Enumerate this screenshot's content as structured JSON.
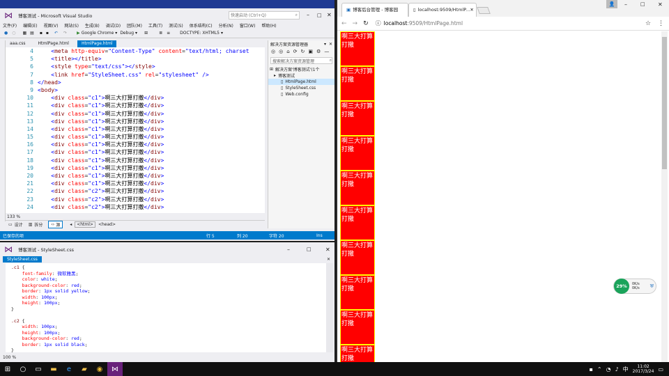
{
  "vs_top": {
    "title": "博客测试 - Microsoft Visual Studio",
    "quick_launch": "快速启动 (Ctrl+Q)",
    "menu": [
      "文件(F)",
      "编辑(E)",
      "视图(V)",
      "网站(S)",
      "生成(B)",
      "调试(D)",
      "团队(M)",
      "工具(T)",
      "测试(S)",
      "体系结构(C)",
      "分析(N)",
      "窗口(W)",
      "帮助(H)"
    ],
    "toolbar": {
      "browser": "Google Chrome",
      "config": "Debug",
      "doctype": "DOCTYPE: XHTML5"
    },
    "tabs": [
      "aaa.css",
      "HtmlPage.html",
      "HtmlPage.html"
    ],
    "code_lines": [
      {
        "n": "4",
        "html": "    <span class='br'>&lt;</span><span class='tagc'>meta</span> <span class='attr'>http-equiv</span>=<span class='val'>\"Content-Type\"</span> <span class='attr'>content</span>=<span class='val'>\"text/html; charset</span>"
      },
      {
        "n": "5",
        "html": "    <span class='br'>&lt;</span><span class='tagc'>title</span><span class='br'>&gt;&lt;/</span><span class='tagc'>title</span><span class='br'>&gt;</span>"
      },
      {
        "n": "6",
        "html": "    <span class='br'>&lt;</span><span class='tagc'>style</span> <span class='attr'>type</span>=<span class='val'>\"text/css\"</span><span class='br'>&gt;&lt;/</span><span class='tagc'>style</span><span class='br'>&gt;</span>"
      },
      {
        "n": "7",
        "html": "    <span class='br'>&lt;</span><span class='tagc'>link</span> <span class='attr'>href</span>=<span class='val'>\"StyleSheet.css\"</span> <span class='attr'>rel</span>=<span class='val'>\"stylesheet\"</span> <span class='br'>/&gt;</span>"
      },
      {
        "n": "8",
        "html": "<span class='br'>&lt;/</span><span class='tagc'>head</span><span class='br'>&gt;</span>"
      },
      {
        "n": "9",
        "html": "<span class='br'>&lt;</span><span class='tagc'>body</span><span class='br'>&gt;</span>"
      }
    ],
    "div_lines": [
      {
        "n": "10",
        "cls": "c1"
      },
      {
        "n": "11",
        "cls": "c1"
      },
      {
        "n": "12",
        "cls": "c1"
      },
      {
        "n": "13",
        "cls": "c1"
      },
      {
        "n": "14",
        "cls": "c1"
      },
      {
        "n": "15",
        "cls": "c1"
      },
      {
        "n": "16",
        "cls": "c1"
      },
      {
        "n": "17",
        "cls": "c1"
      },
      {
        "n": "18",
        "cls": "c1"
      },
      {
        "n": "19",
        "cls": "c1"
      },
      {
        "n": "20",
        "cls": "c1"
      },
      {
        "n": "21",
        "cls": "c1"
      },
      {
        "n": "22",
        "cls": "c2"
      },
      {
        "n": "23",
        "cls": "c2"
      },
      {
        "n": "24",
        "cls": "c2"
      }
    ],
    "div_text": "啊三大打算打撒",
    "zoom": "133 %",
    "bottom_tabs": {
      "design": "设计",
      "split": "拆分",
      "source": "源",
      "html": "<html>",
      "head": "<head>"
    },
    "status": {
      "ready": "已保存的项",
      "line": "行 5",
      "col": "列 20",
      "char": "字符 20",
      "ins": "Ins"
    },
    "solution": {
      "title": "解决方案资源管理器",
      "search": "搜索解决方案资源管理",
      "items": [
        "解决方案'博客测试'(1个",
        "博客测试",
        "HtmlPage.html",
        "StyleSheet.css",
        "Web.config"
      ]
    }
  },
  "vs_bottom": {
    "title": "博客测试 - StyleSheet.css",
    "tab": "StyleSheet.css",
    "zoom": "100 %",
    "css_lines": [
      "<span class='sel'>.c1</span> {",
      "    <span class='prop'>font-family</span>: <span class='pval'>微软雅黑</span>;",
      "    <span class='prop'>color</span>: <span class='pval'>white</span>;",
      "    <span class='prop'>background-color</span>: <span class='pval'>red</span>;",
      "    <span class='prop'>border</span>: <span class='pval'>1px solid yellow</span>;",
      "    <span class='prop'>width</span>: <span class='pval'>100px</span>;",
      "    <span class='prop'>height</span>: <span class='pval'>100px</span>;",
      "}",
      "",
      "<span class='sel'>.c2</span> {",
      "    <span class='prop'>width</span>: <span class='pval'>100px</span>;",
      "    <span class='prop'>height</span>: <span class='pval'>100px</span>;",
      "    <span class='prop'>background-color</span>: <span class='pval'>red</span>;",
      "    <span class='prop'>border</span>: <span class='pval'>1px solid black</span>;",
      "}"
    ]
  },
  "browser": {
    "tabs": [
      "博客后台管理 - 博客园",
      "localhost:9509/HtmlP..."
    ],
    "url_host": "localhost",
    "url_rest": ":9509/HtmlPage.html",
    "box_text": "啊三大打算打撒",
    "box_count": 10,
    "widget_percent": "29%",
    "widget_up": "0K/s",
    "widget_down": "0K/s"
  },
  "taskbar": {
    "time": "11:02",
    "date": "2017/3/24"
  },
  "colors": {
    "accent": "#007acc",
    "red": "#ff0000",
    "yellow": "#ffff00"
  }
}
